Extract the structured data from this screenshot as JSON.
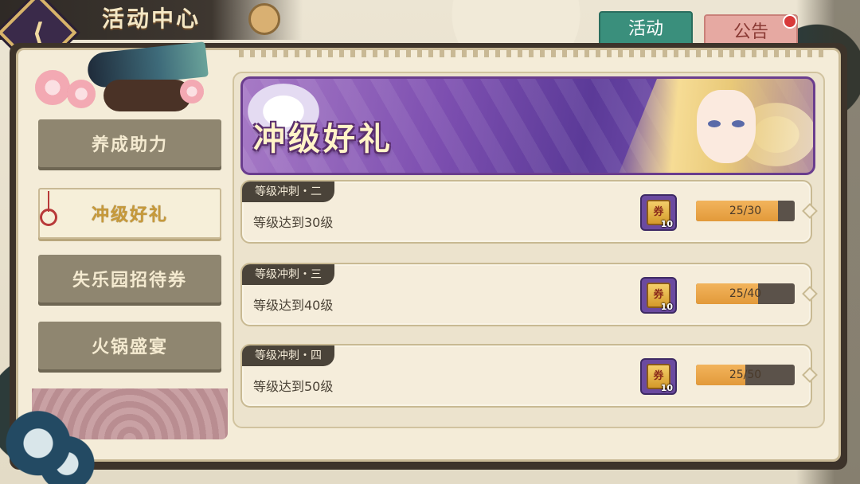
{
  "header": {
    "title": "活动中心",
    "back_glyph": "⟨"
  },
  "tabs": [
    {
      "label": "活动",
      "active": true
    },
    {
      "label": "公告",
      "active": false,
      "has_badge": true
    }
  ],
  "sidebar": {
    "items": [
      {
        "label": "养成助力",
        "active": false
      },
      {
        "label": "冲级好礼",
        "active": true
      },
      {
        "label": "失乐园招待券",
        "active": false
      },
      {
        "label": "火锅盛宴",
        "active": false
      }
    ]
  },
  "banner": {
    "title": "冲级好礼"
  },
  "tasks": [
    {
      "tag": "等级冲刺・二",
      "description": "等级达到30级",
      "reward": {
        "icon": "ticket-icon",
        "glyph": "券",
        "count": "10"
      },
      "progress": {
        "current": 25,
        "total": 30,
        "text": "25/30"
      }
    },
    {
      "tag": "等级冲刺・三",
      "description": "等级达到40级",
      "reward": {
        "icon": "ticket-icon",
        "glyph": "券",
        "count": "10"
      },
      "progress": {
        "current": 25,
        "total": 40,
        "text": "25/40"
      }
    },
    {
      "tag": "等级冲刺・四",
      "description": "等级达到50级",
      "reward": {
        "icon": "ticket-icon",
        "glyph": "券",
        "count": "10"
      },
      "progress": {
        "current": 25,
        "total": 50,
        "text": "25/50"
      }
    }
  ],
  "colors": {
    "tab_active": "#3a8f7c",
    "tab_inactive": "#e6a9a2",
    "progress_fill": "#e29a3a",
    "banner_purple": "#7d4fb0",
    "nav_inactive": "#8f8670"
  }
}
